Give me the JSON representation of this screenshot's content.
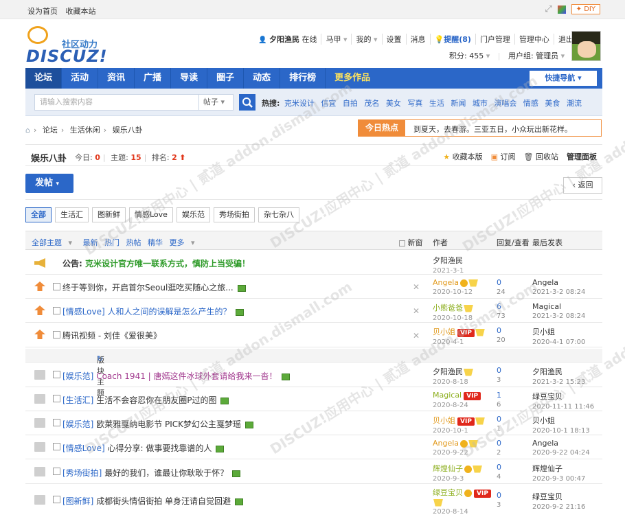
{
  "topbar": {
    "set_home": "设为首页",
    "bookmark": "收藏本站",
    "diy": "DIY"
  },
  "logo": {
    "tagline": "社区动力",
    "wordmark": "DISCUZ!"
  },
  "user": {
    "name": "夕阳渔民",
    "online": "在线",
    "items": [
      "马甲",
      "我的",
      "设置",
      "消息"
    ],
    "reminder": "提醒(8)",
    "portal": "门户管理",
    "admin": "管理中心",
    "logout": "退出",
    "credits": "积分: 455",
    "group": "用户组: 管理员"
  },
  "nav": {
    "items": [
      "论坛",
      "活动",
      "资讯",
      "广播",
      "导读",
      "圈子",
      "动态",
      "排行榜",
      "更多作品"
    ],
    "quick": "快捷导航"
  },
  "search": {
    "placeholder": "请输入搜索内容",
    "type": "帖子",
    "hot_label": "热搜:",
    "hot_words": [
      "克米设计",
      "信宜",
      "自拍",
      "茂名",
      "美女",
      "写真",
      "生活",
      "新闻",
      "城市",
      "演唱会",
      "情感",
      "美食",
      "潮流"
    ]
  },
  "breadcrumb": [
    "论坛",
    "生活休闲",
    "娱乐八卦"
  ],
  "today_hot": {
    "label": "今日热点",
    "text": "到夏天，去春游。三亚五日，小众玩出新花样。"
  },
  "forum": {
    "title": "娱乐八卦",
    "today_label": "今日:",
    "today": "0",
    "topics_label": "主题:",
    "topics": "15",
    "rank_label": "排名:",
    "rank": "2",
    "actions": [
      "收藏本版",
      "订阅",
      "回收站",
      "管理面板"
    ]
  },
  "post_button": "发帖",
  "back_button": "返回",
  "tabs": [
    "全部",
    "生活汇",
    "图新鲜",
    "情感Love",
    "娱乐范",
    "秀场街拍",
    "杂七杂八"
  ],
  "table_header": {
    "filters": [
      "全部主题",
      "最新",
      "热门",
      "热帖",
      "精华",
      "更多"
    ],
    "new": "新窗",
    "author": "作者",
    "reply_view": "回复/查看",
    "last_post": "最后发表"
  },
  "announcement": {
    "label": "公告:",
    "text": "克米设计官方唯一联系方式，慎防上当受骗！",
    "author": "夕阳渔民",
    "date": "2021-3-1"
  },
  "sticky": [
    {
      "cat": "",
      "title": "终于等到你，开启首尔Seoul逛吃买随心之旅...",
      "author": "Angela",
      "date": "2020-10-12",
      "replies": "0",
      "views": "24",
      "last_user": "Angela",
      "last_date": "2021-3-2 08:24"
    },
    {
      "cat": "[情感Love]",
      "title": "人和人之间的误解是怎么产生的？",
      "author": "小熊爸爸",
      "date": "2020-10-18",
      "replies": "6",
      "views": "73",
      "last_user": "Magical",
      "last_date": "2021-3-2 08:24"
    },
    {
      "cat": "",
      "title": "腾讯视频 - 刘佳《爱很美》",
      "author": "贝小姐",
      "date": "2020-4-1",
      "replies": "0",
      "views": "20",
      "last_user": "贝小姐",
      "last_date": "2020-4-1 07:00"
    }
  ],
  "section_label": "版块主题",
  "threads": [
    {
      "cat": "[娱乐范]",
      "title": "Coach 1941 | 唐嫣这件冰球外套请给我来一沓！",
      "author": "夕阳渔民",
      "date": "2020-8-18",
      "replies": "0",
      "views": "3",
      "last_user": "夕阳渔民",
      "last_date": "2021-3-2 15:23"
    },
    {
      "cat": "[生活汇]",
      "title": "生活不会容忍你在朋友圈P过的图",
      "author": "Magical",
      "date": "2020-8-24",
      "replies": "1",
      "views": "6",
      "last_user": "绿豆宝贝",
      "last_date": "2020-11-11 11:46"
    },
    {
      "cat": "[娱乐范]",
      "title": "欧莱雅戛纳电影节 PICK梦幻公主戛梦瑶",
      "author": "贝小姐",
      "date": "2020-10-1",
      "replies": "0",
      "views": "1",
      "last_user": "贝小姐",
      "last_date": "2020-10-1 18:13"
    },
    {
      "cat": "[情感Love]",
      "title": "心得分享: 做事要找靠谱的人",
      "author": "Angela",
      "date": "2020-9-22",
      "replies": "0",
      "views": "2",
      "last_user": "Angela",
      "last_date": "2020-9-22 04:24"
    },
    {
      "cat": "[秀场街拍]",
      "title": "最好的我们，谁最让你耿耿于怀？",
      "author": "辉煌仙子",
      "date": "2020-9-3",
      "replies": "0",
      "views": "4",
      "last_user": "辉煌仙子",
      "last_date": "2020-9-3 00:47"
    },
    {
      "cat": "[图新鲜]",
      "title": "成都街头情侣街拍 单身汪请自觉回避",
      "author": "绿豆宝贝",
      "date": "2020-8-14",
      "replies": "0",
      "views": "3",
      "last_user": "绿豆宝贝",
      "last_date": "2020-9-2 21:16"
    }
  ],
  "watermark": "DISCUZ!应用中心 | 贰道 addon.dismall.com",
  "colors": {
    "brand_blue": "#2b67c8",
    "orange": "#f08c3a",
    "red": "#e1371b"
  }
}
